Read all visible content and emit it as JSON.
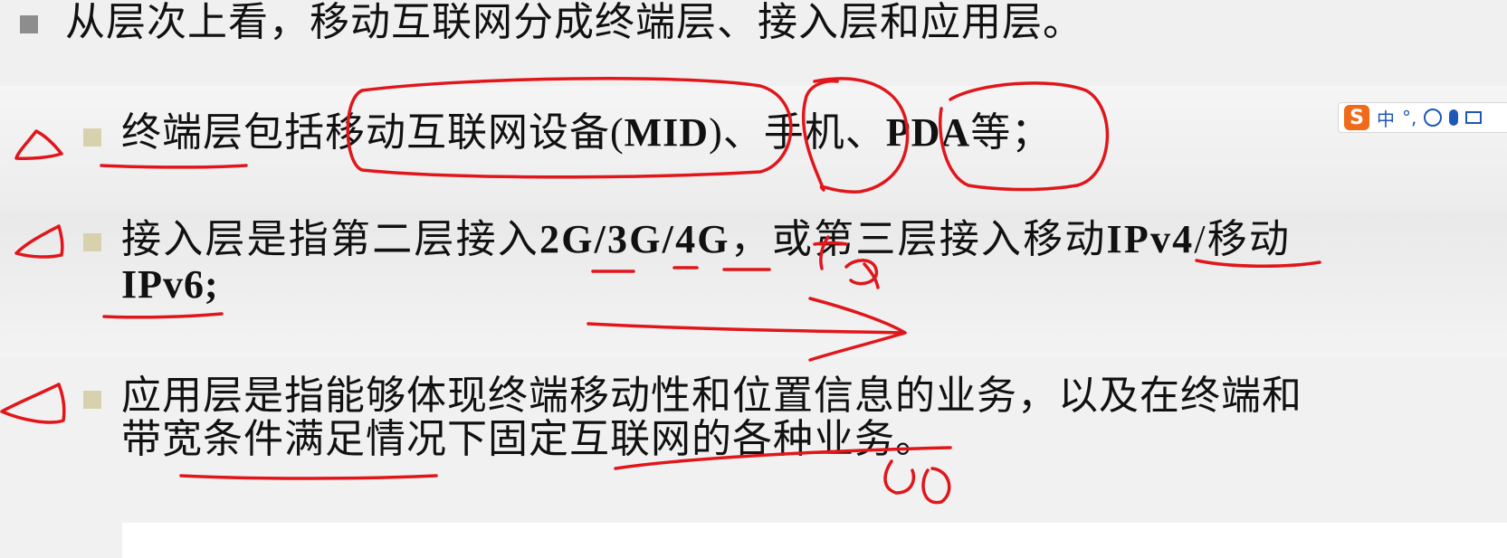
{
  "slide": {
    "heading": "从层次上看，移动互联网分成终端层、接入层和应用层。",
    "items": [
      {
        "seg1": "终端层包括移动互联网设备(",
        "seg2": "MID",
        "seg3": ")、手机、",
        "seg4": "PDA",
        "seg5": "等；"
      },
      {
        "line1_a": "接入层是指第二层接入",
        "line1_b": "2G/3G/4G",
        "line1_c": "，或第三层接入移动",
        "line1_d": "IPv4",
        "line1_e": "/移动",
        "line2_a": "IPv6",
        "line2_b": ";"
      },
      {
        "line1": "应用层是指能够体现终端移动性和位置信息的业务，以及在终端和",
        "line2": "带宽条件满足情况下固定互联网的各种业务。"
      }
    ]
  },
  "annotations": {
    "note_5g": "5G",
    "note_50": "50"
  },
  "ime": {
    "logo": "S",
    "mode": "中"
  },
  "colors": {
    "ink": "#e0161b",
    "bullet_main": "#8d8d8d",
    "bullet_sub": "#d7d2ad"
  }
}
